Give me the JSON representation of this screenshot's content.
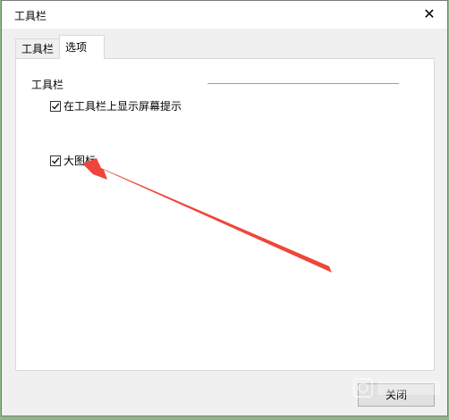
{
  "window": {
    "title": "工具栏",
    "close_glyph": "✕"
  },
  "tabs": [
    {
      "label": "工具栏",
      "active": false
    },
    {
      "label": "选项",
      "active": true
    }
  ],
  "group": {
    "label": "工具栏"
  },
  "options": [
    {
      "label": "在工具栏上显示屏幕提示",
      "checked": true
    },
    {
      "label": "大图标",
      "checked": true
    }
  ],
  "buttons": {
    "close_label": "关闭"
  },
  "annotation": {
    "arrow_color": "#f0453a"
  },
  "colors": {
    "dialog_bg": "#f0f0f0",
    "panel_bg": "#ffffff",
    "desktop_bg": "#8fb58a"
  }
}
